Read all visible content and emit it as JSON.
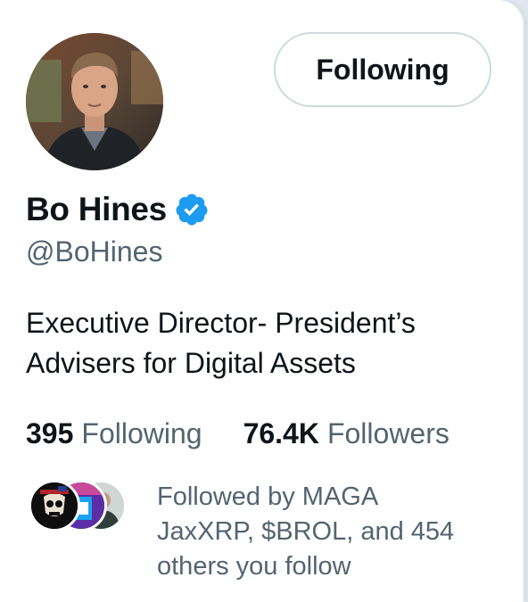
{
  "profile": {
    "name": "Bo Hines",
    "handle": "@BoHines",
    "verified": true,
    "badge_icon": "verified-badge-icon",
    "bio_line1": "Executive Director- President’s",
    "bio_line2": "Advisers for Digital Assets"
  },
  "actions": {
    "follow_label": "Following"
  },
  "stats": {
    "following_count": "395",
    "following_label": "Following",
    "followers_count": "76.4K",
    "followers_label": "Followers"
  },
  "followed_by": {
    "line1": "Followed by MAGA",
    "line2": "JaxXRP, $BROL, and 454",
    "line3": "others you follow"
  },
  "colors": {
    "verified": "#1d9bf0",
    "text_primary": "#0f1419",
    "text_secondary": "#536471",
    "button_border": "#cfd9de"
  }
}
